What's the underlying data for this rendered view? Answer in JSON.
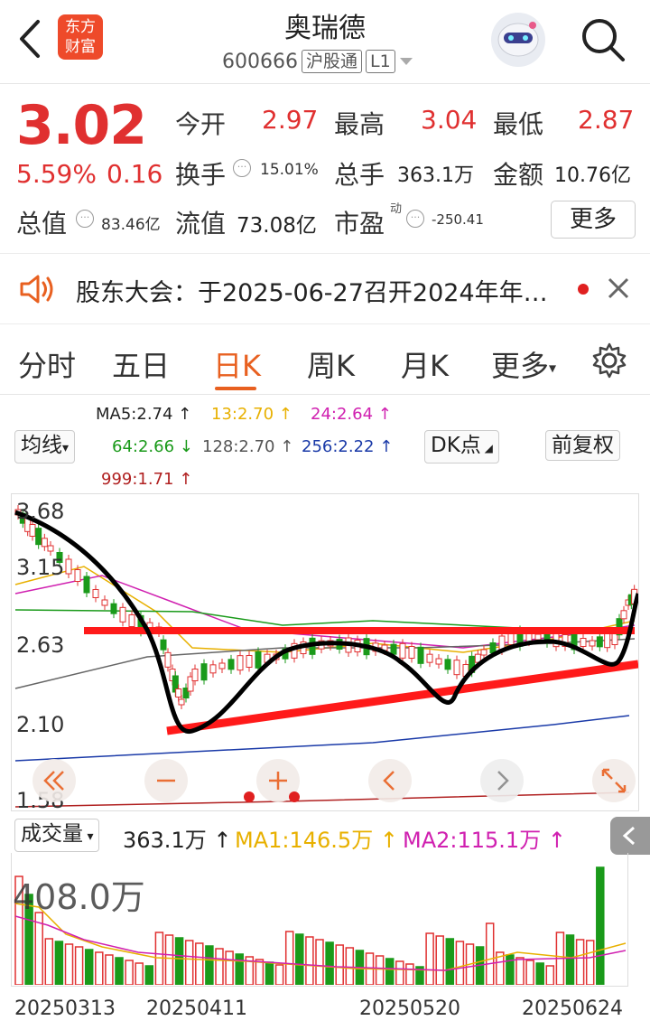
{
  "header": {
    "logo_line1": "东方",
    "logo_line2": "财富",
    "stock_name": "奥瑞德",
    "stock_code": "600666",
    "tag_connect": "沪股通",
    "tag_level": "L1"
  },
  "quote": {
    "price": "3.02",
    "change_pct": "5.59%",
    "change_amt": "0.16",
    "open_label": "今开",
    "open": "2.97",
    "high_label": "最高",
    "high": "3.04",
    "low_label": "最低",
    "low": "2.87",
    "turnover_label": "换手",
    "turnover": "15.01%",
    "volume_label": "总手",
    "volume": "363.1万",
    "amount_label": "金额",
    "amount": "10.76亿",
    "mktcap_label": "总值",
    "mktcap": "83.46亿",
    "float_label": "流值",
    "float_cap": "73.08亿",
    "pe_label": "市盈",
    "pe_sup": "动",
    "pe": "-250.41",
    "more": "更多"
  },
  "notice": {
    "text": "股东大会：于2025-06-27召开2024年年…"
  },
  "tabs": [
    "分时",
    "五日",
    "日K",
    "周K",
    "月K",
    "更多"
  ],
  "active_tab": "日K",
  "indicators": {
    "ma5": "MA5:2.74 ↑",
    "ma13": "13:2.70 ↑",
    "ma24": "24:2.64 ↑",
    "ma64": "64:2.66 ↓",
    "ma128": "128:2.70 ↑",
    "ma256": "256:2.22 ↑",
    "ma999": "999:1.71 ↑",
    "avg_btn": "均线",
    "dk_btn": "DK点",
    "adj_btn": "前复权"
  },
  "chart_axis": {
    "y_top": "3.68",
    "y_2": "3.15",
    "y_3": "2.63",
    "y_4": "2.10",
    "y_5": "1.58"
  },
  "volume": {
    "label": "成交量",
    "value": "363.1万 ↑",
    "ma1": "MA1:146.5万 ↑",
    "ma2": "MA2:115.1万 ↑",
    "scale": "408.0万"
  },
  "dates": [
    "20250313",
    "20250411",
    "20250520",
    "20250624"
  ],
  "colors": {
    "up": "#e03030",
    "down": "#1a9a1a",
    "accent": "#e86020"
  }
}
